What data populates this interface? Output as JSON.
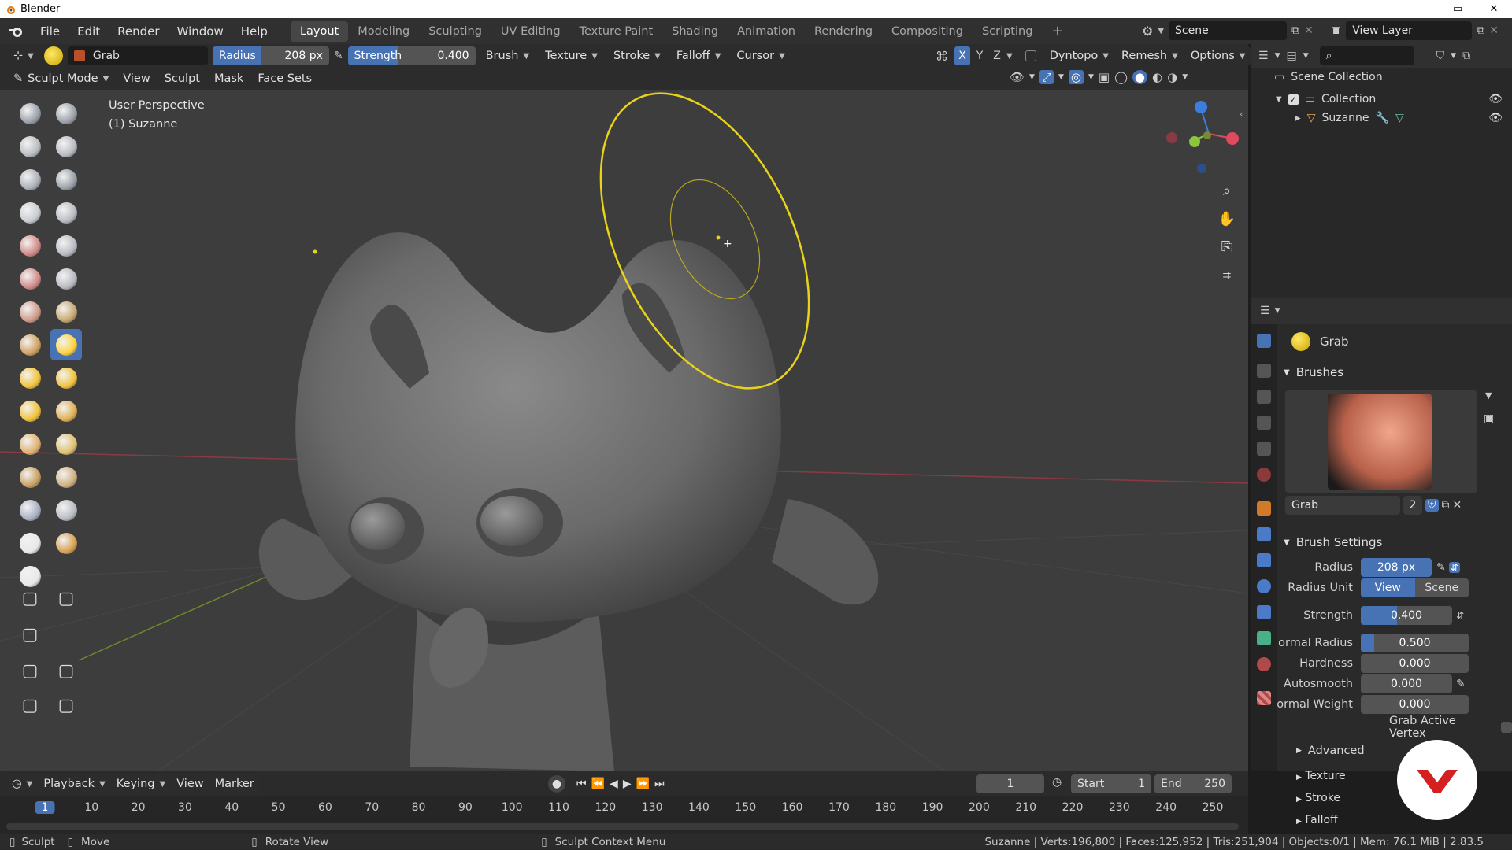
{
  "window": {
    "title": "Blender",
    "minimize": "–",
    "maximize": "▭",
    "close": "✕"
  },
  "menu": [
    "File",
    "Edit",
    "Render",
    "Window",
    "Help"
  ],
  "workspaces": [
    "Layout",
    "Modeling",
    "Sculpting",
    "UV Editing",
    "Texture Paint",
    "Shading",
    "Animation",
    "Rendering",
    "Compositing",
    "Scripting"
  ],
  "workspace_add": "+",
  "scene": {
    "name": "Scene"
  },
  "view_layer": {
    "name": "View Layer"
  },
  "tool_header": {
    "brush_name": "Grab",
    "radius_label": "Radius",
    "radius_value": "208 px",
    "strength_label": "Strength",
    "strength_value": "0.400",
    "strength_fraction": 0.4,
    "menus": [
      "Brush",
      "Texture",
      "Stroke",
      "Falloff",
      "Cursor"
    ],
    "axes": [
      "X",
      "Y",
      "Z"
    ],
    "dyntopo": "Dyntopo",
    "remesh": "Remesh",
    "options": "Options"
  },
  "view_header": {
    "mode": "Sculpt Mode",
    "menus": [
      "View",
      "Sculpt",
      "Mask",
      "Face Sets"
    ]
  },
  "viewport": {
    "perspective": "User Perspective",
    "object": "(1) Suzanne",
    "gizmo_axes": [
      "X",
      "Y",
      "Z"
    ]
  },
  "outliner": {
    "scene_collection": "Scene Collection",
    "collection": "Collection",
    "object": "Suzanne"
  },
  "properties": {
    "tool_name": "Grab",
    "brushes_header": "Brushes",
    "brush_name": "Grab",
    "brush_users": "2",
    "brush_settings_header": "Brush Settings",
    "radius": {
      "label": "Radius",
      "value": "208 px"
    },
    "radius_unit": {
      "label": "Radius Unit",
      "options": [
        "View",
        "Scene"
      ],
      "selected": "View"
    },
    "strength": {
      "label": "Strength",
      "value": "0.400",
      "fraction": 0.4
    },
    "normal_radius": {
      "label": "Normal Radius",
      "value": "0.500",
      "fraction": 0.5
    },
    "hardness": {
      "label": "Hardness",
      "value": "0.000"
    },
    "autosmooth": {
      "label": "Autosmooth",
      "value": "0.000"
    },
    "normal_weight": {
      "label": "Normal Weight",
      "value": "0.000"
    },
    "grab_active_vertex": {
      "label": "Grab Active Vertex",
      "checked": false
    },
    "subpanels": [
      "Advanced",
      "Texture",
      "Stroke",
      "Falloff"
    ]
  },
  "timeline": {
    "menus": [
      "Playback",
      "Keying",
      "View",
      "Marker"
    ],
    "current_frame": "1",
    "start_label": "Start",
    "start": "1",
    "end_label": "End",
    "end": "250",
    "ticks": [
      "1",
      "10",
      "20",
      "30",
      "40",
      "50",
      "60",
      "70",
      "80",
      "90",
      "100",
      "110",
      "120",
      "130",
      "140",
      "150",
      "160",
      "170",
      "180",
      "190",
      "200",
      "210",
      "220",
      "230",
      "240",
      "250"
    ]
  },
  "statusbar": {
    "left_action": "Sculpt",
    "middle_action": "Move",
    "rotate": "Rotate View",
    "context": "Sculpt Context Menu",
    "stats": "Suzanne | Verts:196,800 | Faces:125,952 | Tris:251,904 | Objects:0/1 | Mem: 76.1 MiB | 2.83.5"
  },
  "colors": {
    "accent": "#4772b3",
    "brush_circle": "#e8d21a",
    "header": "#303030",
    "viewport": "#3d3d3d",
    "x_axis": "#e04a5e",
    "y_axis": "#8cc63e",
    "z_axis": "#3c7ee0"
  }
}
